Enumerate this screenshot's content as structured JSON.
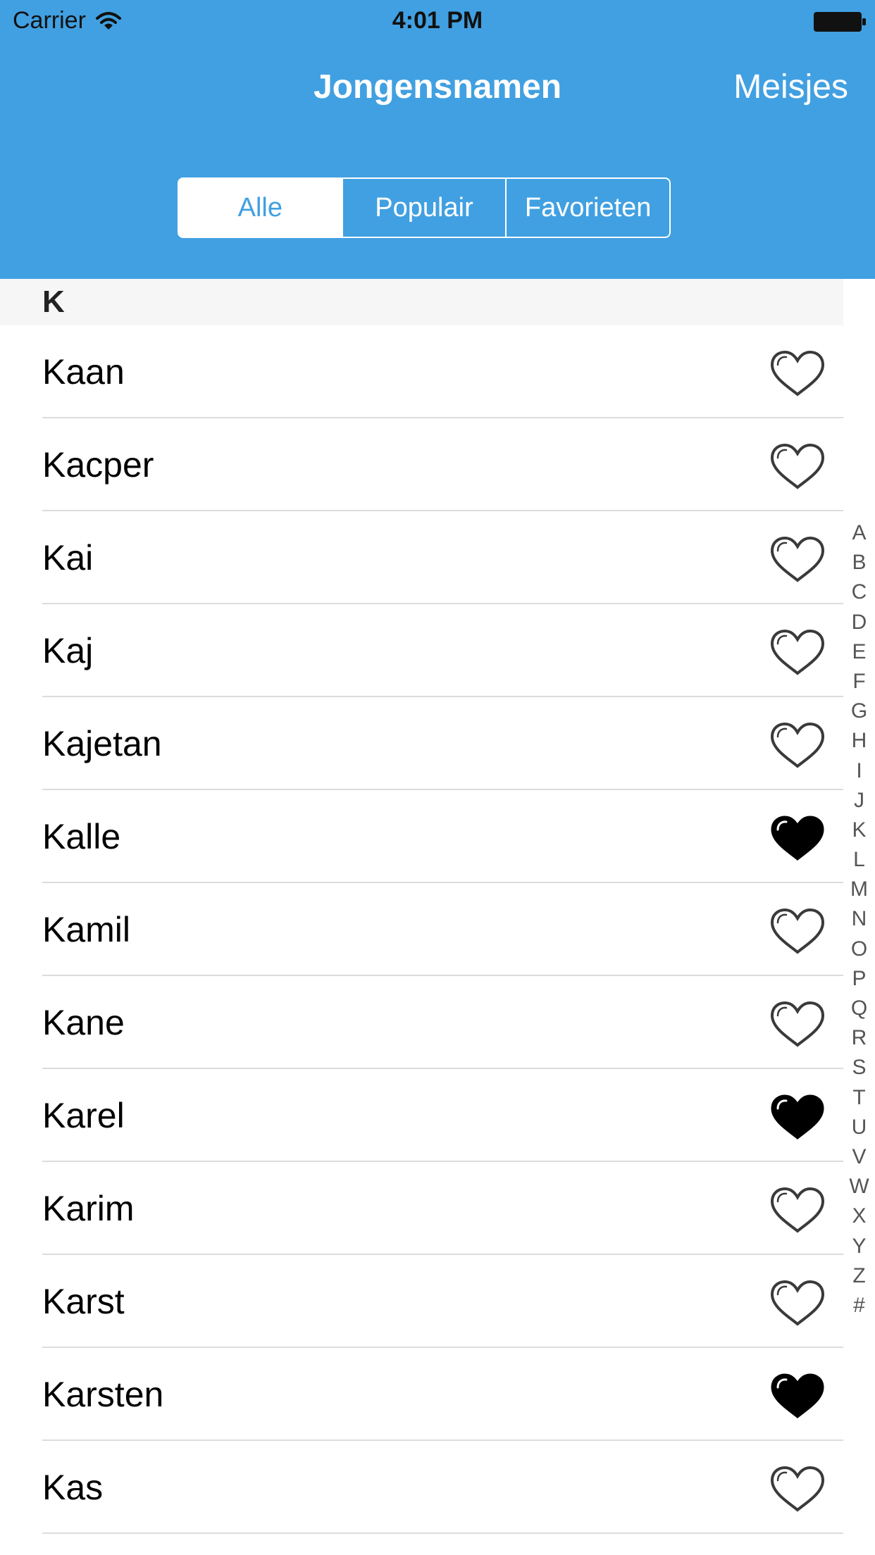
{
  "status_bar": {
    "carrier": "Carrier",
    "time": "4:01 PM"
  },
  "nav": {
    "title": "Jongensnamen",
    "right_button": "Meisjes"
  },
  "segments": [
    {
      "label": "Alle",
      "selected": true
    },
    {
      "label": "Populair",
      "selected": false
    },
    {
      "label": "Favorieten",
      "selected": false
    }
  ],
  "section": {
    "letter": "K"
  },
  "names": [
    {
      "name": "Kaan",
      "favorite": false
    },
    {
      "name": "Kacper",
      "favorite": false
    },
    {
      "name": "Kai",
      "favorite": false
    },
    {
      "name": "Kaj",
      "favorite": false
    },
    {
      "name": "Kajetan",
      "favorite": false
    },
    {
      "name": "Kalle",
      "favorite": true
    },
    {
      "name": "Kamil",
      "favorite": false
    },
    {
      "name": "Kane",
      "favorite": false
    },
    {
      "name": "Karel",
      "favorite": true
    },
    {
      "name": "Karim",
      "favorite": false
    },
    {
      "name": "Karst",
      "favorite": false
    },
    {
      "name": "Karsten",
      "favorite": true
    },
    {
      "name": "Kas",
      "favorite": false
    }
  ],
  "index_letters": [
    "A",
    "B",
    "C",
    "D",
    "E",
    "F",
    "G",
    "H",
    "I",
    "J",
    "K",
    "L",
    "M",
    "N",
    "O",
    "P",
    "Q",
    "R",
    "S",
    "T",
    "U",
    "V",
    "W",
    "X",
    "Y",
    "Z",
    "#"
  ],
  "colors": {
    "accent": "#41a0e1",
    "section_bg": "#f6f6f6",
    "separator": "#dcdcdc"
  },
  "icons": {
    "favorite_on": "heart-filled-icon",
    "favorite_off": "heart-outline-icon"
  }
}
